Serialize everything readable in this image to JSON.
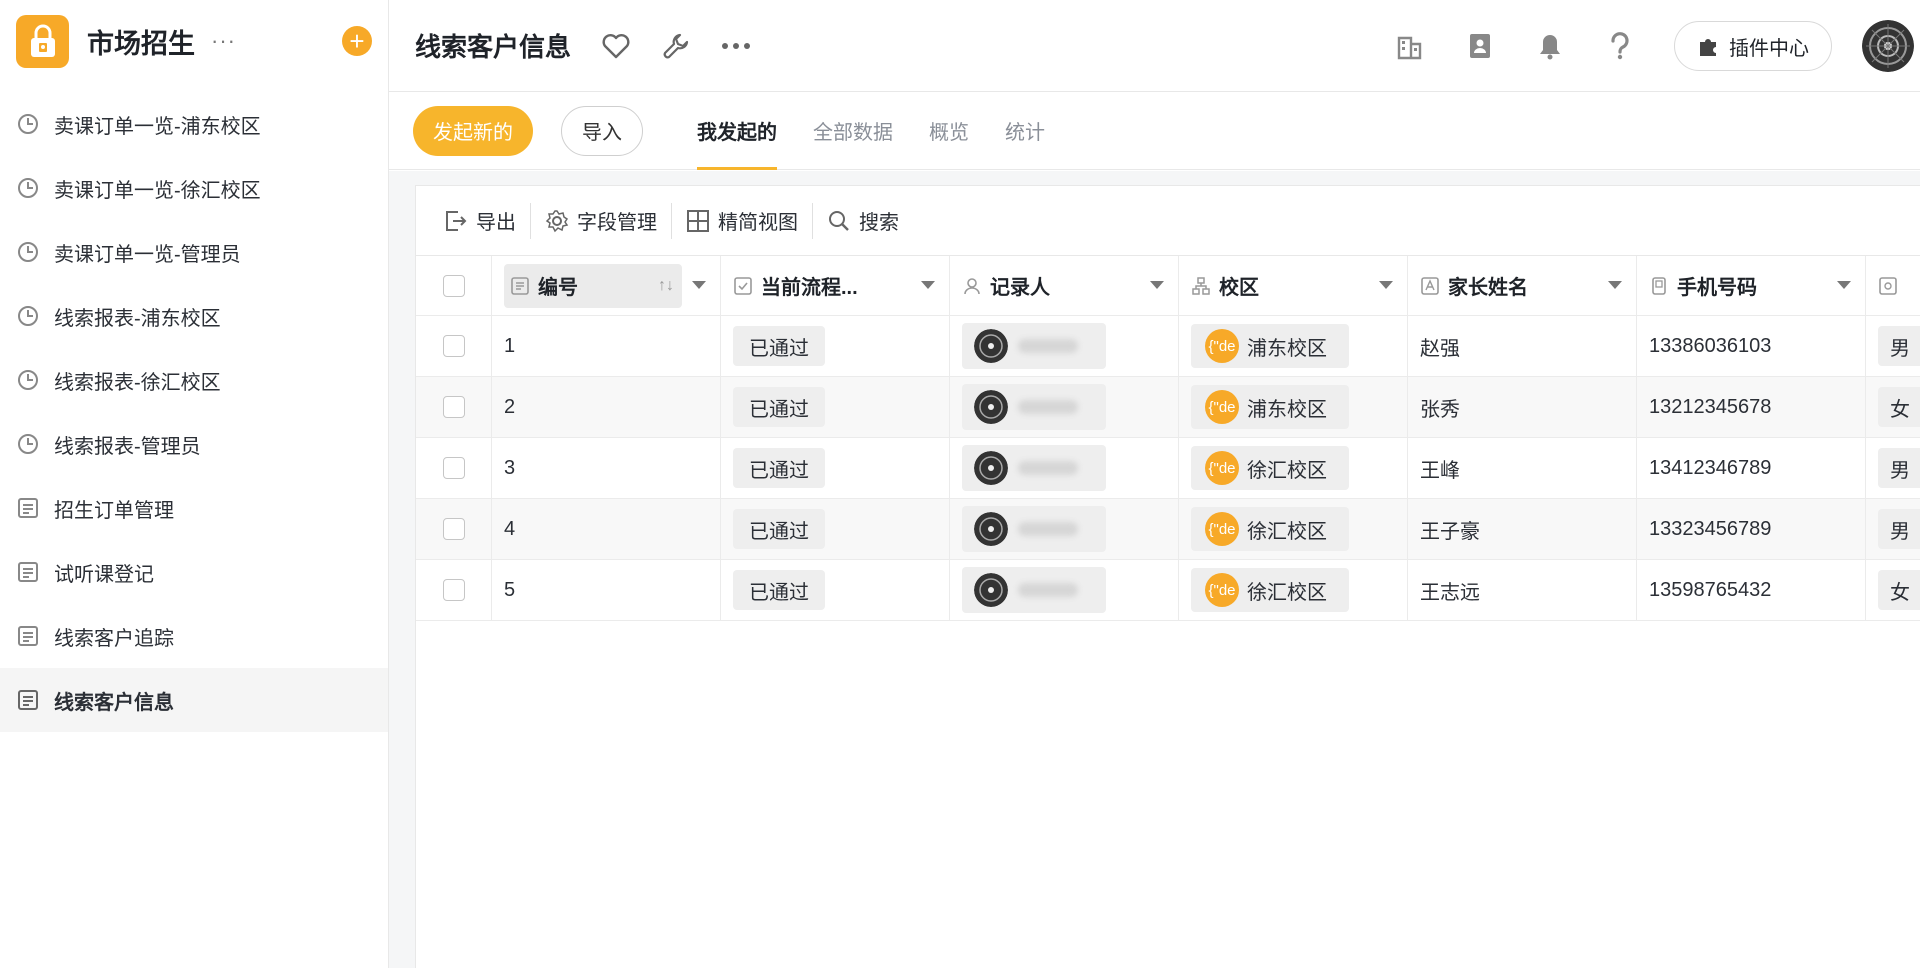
{
  "app": {
    "name": "市场招生",
    "more": "···",
    "add": "+"
  },
  "sidebar": {
    "items": [
      {
        "label": "卖课订单一览-浦东校区",
        "icon": "clock-icon"
      },
      {
        "label": "卖课订单一览-徐汇校区",
        "icon": "clock-icon"
      },
      {
        "label": "卖课订单一览-管理员",
        "icon": "clock-icon"
      },
      {
        "label": "线索报表-浦东校区",
        "icon": "clock-icon"
      },
      {
        "label": "线索报表-徐汇校区",
        "icon": "clock-icon"
      },
      {
        "label": "线索报表-管理员",
        "icon": "clock-icon"
      },
      {
        "label": "招生订单管理",
        "icon": "form-icon"
      },
      {
        "label": "试听课登记",
        "icon": "form-icon"
      },
      {
        "label": "线索客户追踪",
        "icon": "form-icon"
      },
      {
        "label": "线索客户信息",
        "icon": "form-icon",
        "active": true
      }
    ]
  },
  "header": {
    "title": "线索客户信息",
    "more": "···",
    "plugin_label": "插件中心"
  },
  "actions": {
    "new_label": "发起新的",
    "import_label": "导入"
  },
  "tabs": [
    {
      "label": "我发起的",
      "active": true
    },
    {
      "label": "全部数据"
    },
    {
      "label": "概览"
    },
    {
      "label": "统计"
    }
  ],
  "toolbar": {
    "export": "导出",
    "fields": "字段管理",
    "compact": "精简视图",
    "search": "搜索"
  },
  "table": {
    "columns": [
      "编号",
      "当前流程...",
      "记录人",
      "校区",
      "家长姓名",
      "手机号码"
    ],
    "rows": [
      {
        "id": "1",
        "status": "已通过",
        "campus_badge": "{\"de",
        "campus": "浦东校区",
        "parent": "赵强",
        "phone": "13386036103",
        "gender": "男"
      },
      {
        "id": "2",
        "status": "已通过",
        "campus_badge": "{\"de",
        "campus": "浦东校区",
        "parent": "张秀",
        "phone": "13212345678",
        "gender": "女"
      },
      {
        "id": "3",
        "status": "已通过",
        "campus_badge": "{\"de",
        "campus": "徐汇校区",
        "parent": "王峰",
        "phone": "13412346789",
        "gender": "男"
      },
      {
        "id": "4",
        "status": "已通过",
        "campus_badge": "{\"de",
        "campus": "徐汇校区",
        "parent": "王子豪",
        "phone": "13323456789",
        "gender": "男"
      },
      {
        "id": "5",
        "status": "已通过",
        "campus_badge": "{\"de",
        "campus": "徐汇校区",
        "parent": "王志远",
        "phone": "13598765432",
        "gender": "女"
      }
    ]
  },
  "colors": {
    "accent": "#f7a928",
    "button": "#f7b52c"
  }
}
